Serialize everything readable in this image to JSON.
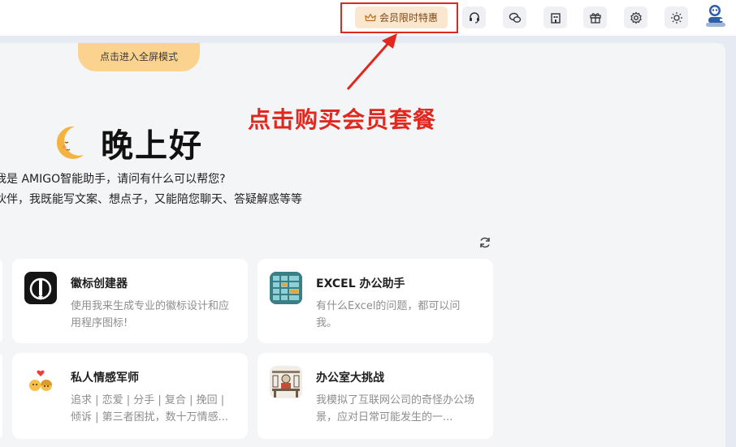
{
  "header": {
    "vip_label": "会员限时特惠",
    "buttons": [
      {
        "name": "headset-icon"
      },
      {
        "name": "wechat-icon"
      },
      {
        "name": "building-icon"
      },
      {
        "name": "gift-icon"
      },
      {
        "name": "gear-icon"
      },
      {
        "name": "sun-icon"
      }
    ]
  },
  "main": {
    "fullscreen_label": "点击进入全屏模式",
    "greeting": "晚上好",
    "intro_line1": "我是 AMIGO智能助手，请问有什么可以帮您?",
    "intro_line2": "伙伴，我既能写文案、想点子，又能陪您聊天、答疑解惑等等",
    "cards": [
      {
        "title": "徽标创建器",
        "desc": "使用我来生成专业的徽标设计和应用程序图标!",
        "icon": "logo-brush-icon"
      },
      {
        "title": "EXCEL 办公助手",
        "desc": "有什么Excel的问题，都可以问我。",
        "icon": "spreadsheet-icon"
      },
      {
        "title": "私人情感军师",
        "desc": "追求 | 恋爱 | 分手 | 复合 | 挽回 | 倾诉 | 第三者困扰，数十万情感...",
        "icon": "couple-heart-icon"
      },
      {
        "title": "办公室大挑战",
        "desc": "我模拟了互联网公司的奇怪办公场景，应对日常可能发生的一...",
        "icon": "office-sketch-icon"
      }
    ]
  },
  "annotation": {
    "text": "点击购买会员套餐",
    "color": "#e0281e"
  },
  "colors": {
    "vip_bg": "#fbe6cf",
    "fullscreen_tab": "#fbd38f",
    "panel_bg": "#f4f5f7"
  }
}
